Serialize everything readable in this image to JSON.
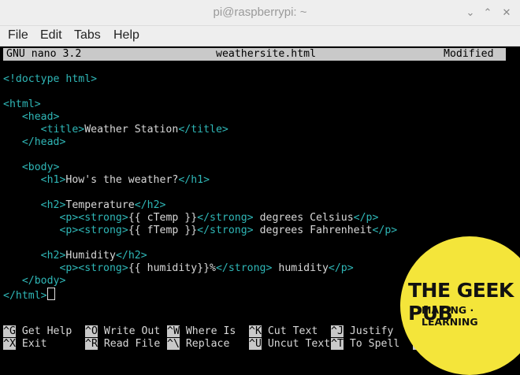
{
  "window": {
    "title": "pi@raspberrypi: ~"
  },
  "menu": [
    "File",
    "Edit",
    "Tabs",
    "Help"
  ],
  "nano": {
    "app": "GNU nano 3.2",
    "filename": "weathersite.html",
    "status": "Modified"
  },
  "code": [
    [
      [
        "t",
        "<!doctype html>"
      ]
    ],
    [],
    [
      [
        "t",
        "<html>"
      ]
    ],
    [
      [
        "x",
        "   "
      ],
      [
        "t",
        "<head>"
      ]
    ],
    [
      [
        "x",
        "      "
      ],
      [
        "t",
        "<title>"
      ],
      [
        "x",
        "Weather Station"
      ],
      [
        "t",
        "</title>"
      ]
    ],
    [
      [
        "x",
        "   "
      ],
      [
        "t",
        "</head>"
      ]
    ],
    [],
    [
      [
        "x",
        "   "
      ],
      [
        "t",
        "<body>"
      ]
    ],
    [
      [
        "x",
        "      "
      ],
      [
        "t",
        "<h1>"
      ],
      [
        "x",
        "How's the weather?"
      ],
      [
        "t",
        "</h1>"
      ]
    ],
    [],
    [
      [
        "x",
        "      "
      ],
      [
        "t",
        "<h2>"
      ],
      [
        "x",
        "Temperature"
      ],
      [
        "t",
        "</h2>"
      ]
    ],
    [
      [
        "x",
        "         "
      ],
      [
        "t",
        "<p><strong>"
      ],
      [
        "x",
        "{{ cTemp }}"
      ],
      [
        "t",
        "</strong>"
      ],
      [
        "x",
        " degrees Celsius"
      ],
      [
        "t",
        "</p>"
      ]
    ],
    [
      [
        "x",
        "         "
      ],
      [
        "t",
        "<p><strong>"
      ],
      [
        "x",
        "{{ fTemp }}"
      ],
      [
        "t",
        "</strong>"
      ],
      [
        "x",
        " degrees Fahrenheit"
      ],
      [
        "t",
        "</p>"
      ]
    ],
    [],
    [
      [
        "x",
        "      "
      ],
      [
        "t",
        "<h2>"
      ],
      [
        "x",
        "Humidity"
      ],
      [
        "t",
        "</h2>"
      ]
    ],
    [
      [
        "x",
        "         "
      ],
      [
        "t",
        "<p><strong>"
      ],
      [
        "x",
        "{{ humidity}}%"
      ],
      [
        "t",
        "</strong>"
      ],
      [
        "x",
        " humidity"
      ],
      [
        "t",
        "</p>"
      ]
    ],
    [
      [
        "x",
        "   "
      ],
      [
        "t",
        "</body>"
      ]
    ],
    [
      [
        "t",
        "</html>"
      ]
    ]
  ],
  "shortcuts_row1": [
    {
      "key": "^G",
      "label": "Get Help"
    },
    {
      "key": "^O",
      "label": "Write Out"
    },
    {
      "key": "^W",
      "label": "Where Is"
    },
    {
      "key": "^K",
      "label": "Cut Text"
    },
    {
      "key": "^J",
      "label": "Justify"
    },
    {
      "key": "^",
      "label": ""
    }
  ],
  "shortcuts_row2": [
    {
      "key": "^X",
      "label": "Exit"
    },
    {
      "key": "^R",
      "label": "Read File"
    },
    {
      "key": "^\\",
      "label": "Replace"
    },
    {
      "key": "^U",
      "label": "Uncut Text"
    },
    {
      "key": "^T",
      "label": "To Spell"
    },
    {
      "key": "^",
      "label": ""
    }
  ],
  "badge": {
    "line1": "THE GEEK PUB",
    "line2": "MAKING · LEARNING",
    "color": "#f4e53a"
  },
  "colors": {
    "tag": "#2fb7b7",
    "text": "#d8d8d8",
    "header_bg": "#c9c9c9"
  }
}
